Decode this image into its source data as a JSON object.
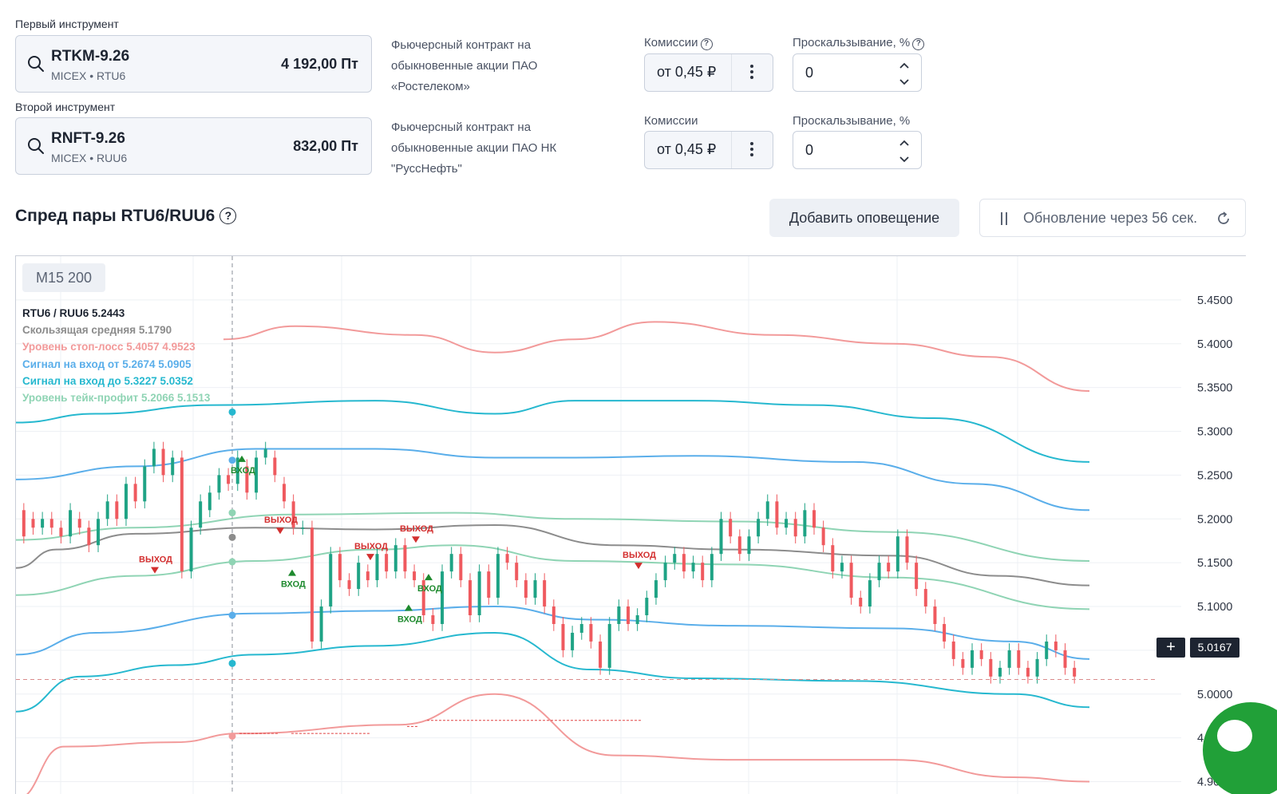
{
  "first": {
    "label": "Первый инструмент",
    "ticker": "RTKM-9.26",
    "exchange": "MICEX • RTU6",
    "price": "4 192,00 Пт",
    "description": [
      "Фьючерсный контракт на",
      "обыкновенные акции ПАО",
      "«Ростелеком»"
    ],
    "commission_label": "Комиссии",
    "commission_value": "от 0,45 ₽",
    "slippage_label": "Проскальзывание, %",
    "slippage_value": "0"
  },
  "second": {
    "label": "Второй инструмент",
    "ticker": "RNFT-9.26",
    "exchange": "MICEX • RUU6",
    "price": "832,00 Пт",
    "description": [
      "Фьючерсный контракт на",
      "обыкновенные акции ПАО НК",
      "\"РуссНефть\""
    ],
    "commission_label": "Комиссии",
    "commission_value": "от 0,45 ₽",
    "slippage_label": "Проскальзывание, %",
    "slippage_value": "0"
  },
  "spread": {
    "title": "Спред пары RTU6/RUU6",
    "add_alert": "Добавить оповещение",
    "refresh": "Обновление через 56 сек."
  },
  "chart_data": {
    "type": "candlestick",
    "timeframe_badge": "M15 200",
    "current_price": "5.0167",
    "legend": [
      {
        "text": "RTU6 / RUU6 5.2443",
        "color": "#1d2431"
      },
      {
        "text": "Скользящая средняя 5.1790",
        "color": "#8c8c8c"
      },
      {
        "text": "Уровень стоп-лосс 5.4057 4.9523",
        "color": "#f29a9a"
      },
      {
        "text": "Сигнал на вход от 5.2674 5.0905",
        "color": "#5aaeea"
      },
      {
        "text": "Сигнал на вход до 5.3227 5.0352",
        "color": "#26b8cf"
      },
      {
        "text": "Уровень тейк-профит 5.2066 5.1513",
        "color": "#8fd4b4"
      }
    ],
    "y_ticks": [
      "5.4500",
      "5.4000",
      "5.3500",
      "5.3000",
      "5.2500",
      "5.2000",
      "5.1500",
      "5.1000",
      "5.0500",
      "5.0000",
      "4.9500",
      "4.9000"
    ],
    "ylim": [
      4.885,
      5.5
    ],
    "signal_labels": {
      "entry": "ВХОД",
      "exit": "ВЫХОД"
    },
    "colors": {
      "up": "#1fa385",
      "down": "#ef5a5f",
      "ma": "#8c8c8c",
      "sl": "#f29a9a",
      "entry_from": "#5aaeea",
      "entry_to": "#26b8cf",
      "tp": "#8fd4b4"
    },
    "ma": [
      [
        0,
        5.144
      ],
      [
        50,
        5.165
      ],
      [
        150,
        5.183
      ],
      [
        300,
        5.19
      ],
      [
        450,
        5.188
      ],
      [
        600,
        5.193
      ],
      [
        750,
        5.17
      ],
      [
        900,
        5.165
      ],
      [
        1100,
        5.158
      ],
      [
        1230,
        5.135
      ],
      [
        1345,
        5.124
      ]
    ],
    "stop_upper": [
      [
        260,
        5.405
      ],
      [
        350,
        5.42
      ],
      [
        500,
        5.41
      ],
      [
        600,
        5.39
      ],
      [
        700,
        5.405
      ],
      [
        800,
        5.425
      ],
      [
        950,
        5.41
      ],
      [
        1100,
        5.4
      ],
      [
        1220,
        5.385
      ],
      [
        1345,
        5.346
      ]
    ],
    "stop_lower": [
      [
        0,
        4.88
      ],
      [
        60,
        4.94
      ],
      [
        200,
        4.945
      ],
      [
        280,
        4.955
      ],
      [
        480,
        4.965
      ],
      [
        600,
        5.0
      ],
      [
        750,
        4.93
      ],
      [
        900,
        4.925
      ],
      [
        1100,
        4.925
      ],
      [
        1250,
        4.905
      ],
      [
        1345,
        4.9
      ]
    ],
    "entry_to_upper": [
      [
        0,
        5.31
      ],
      [
        100,
        5.32
      ],
      [
        250,
        5.33
      ],
      [
        450,
        5.335
      ],
      [
        600,
        5.32
      ],
      [
        700,
        5.335
      ],
      [
        850,
        5.335
      ],
      [
        1000,
        5.33
      ],
      [
        1150,
        5.315
      ],
      [
        1345,
        5.265
      ]
    ],
    "entry_to_lower": [
      [
        0,
        4.98
      ],
      [
        80,
        5.02
      ],
      [
        200,
        5.033
      ],
      [
        300,
        5.045
      ],
      [
        450,
        5.055
      ],
      [
        600,
        5.07
      ],
      [
        720,
        5.028
      ],
      [
        850,
        5.018
      ],
      [
        1050,
        5.015
      ],
      [
        1250,
        5.0
      ],
      [
        1345,
        4.985
      ]
    ],
    "entry_from_upper": [
      [
        0,
        5.245
      ],
      [
        150,
        5.26
      ],
      [
        300,
        5.28
      ],
      [
        450,
        5.28
      ],
      [
        600,
        5.27
      ],
      [
        700,
        5.27
      ],
      [
        850,
        5.272
      ],
      [
        1050,
        5.265
      ],
      [
        1200,
        5.24
      ],
      [
        1345,
        5.21
      ]
    ],
    "entry_from_lower": [
      [
        0,
        5.045
      ],
      [
        100,
        5.07
      ],
      [
        300,
        5.092
      ],
      [
        450,
        5.095
      ],
      [
        600,
        5.1
      ],
      [
        720,
        5.085
      ],
      [
        900,
        5.078
      ],
      [
        1100,
        5.075
      ],
      [
        1250,
        5.06
      ],
      [
        1345,
        5.04
      ]
    ],
    "tp_upper": [
      [
        0,
        5.176
      ],
      [
        150,
        5.19
      ],
      [
        350,
        5.205
      ],
      [
        550,
        5.207
      ],
      [
        700,
        5.2
      ],
      [
        900,
        5.197
      ],
      [
        1100,
        5.185
      ],
      [
        1345,
        5.152
      ]
    ],
    "tp_lower": [
      [
        0,
        5.113
      ],
      [
        150,
        5.135
      ],
      [
        300,
        5.152
      ],
      [
        450,
        5.165
      ],
      [
        550,
        5.17
      ],
      [
        700,
        5.152
      ],
      [
        900,
        5.148
      ],
      [
        1100,
        5.133
      ],
      [
        1345,
        5.097
      ]
    ],
    "crosshair_x": 271,
    "candles": [
      [
        5.21,
        5.18
      ],
      [
        5.2,
        5.19
      ],
      [
        5.19,
        5.2
      ],
      [
        5.2,
        5.19
      ],
      [
        5.19,
        5.18
      ],
      [
        5.18,
        5.21
      ],
      [
        5.2,
        5.19
      ],
      [
        5.19,
        5.17
      ],
      [
        5.17,
        5.2
      ],
      [
        5.2,
        5.22
      ],
      [
        5.22,
        5.2
      ],
      [
        5.2,
        5.24
      ],
      [
        5.24,
        5.22
      ],
      [
        5.22,
        5.26
      ],
      [
        5.26,
        5.28
      ],
      [
        5.28,
        5.25
      ],
      [
        5.25,
        5.27
      ],
      [
        5.27,
        5.14
      ],
      [
        5.14,
        5.19
      ],
      [
        5.19,
        5.22
      ],
      [
        5.21,
        5.23
      ],
      [
        5.23,
        5.25
      ],
      [
        5.25,
        5.24
      ],
      [
        5.24,
        5.27
      ],
      [
        5.26,
        5.23
      ],
      [
        5.23,
        5.27
      ],
      [
        5.27,
        5.28
      ],
      [
        5.27,
        5.25
      ],
      [
        5.24,
        5.22
      ],
      [
        5.22,
        5.19
      ],
      [
        5.19,
        5.19
      ],
      [
        5.19,
        5.06
      ],
      [
        5.06,
        5.1
      ],
      [
        5.1,
        5.16
      ],
      [
        5.16,
        5.13
      ],
      [
        5.13,
        5.12
      ],
      [
        5.12,
        5.15
      ],
      [
        5.14,
        5.13
      ],
      [
        5.13,
        5.16
      ],
      [
        5.16,
        5.14
      ],
      [
        5.14,
        5.17
      ],
      [
        5.17,
        5.14
      ],
      [
        5.14,
        5.13
      ],
      [
        5.13,
        5.09
      ],
      [
        5.09,
        5.08
      ],
      [
        5.08,
        5.14
      ],
      [
        5.14,
        5.16
      ],
      [
        5.16,
        5.13
      ],
      [
        5.13,
        5.09
      ],
      [
        5.09,
        5.14
      ],
      [
        5.14,
        5.11
      ],
      [
        5.11,
        5.16
      ],
      [
        5.16,
        5.15
      ],
      [
        5.15,
        5.13
      ],
      [
        5.13,
        5.11
      ],
      [
        5.11,
        5.13
      ],
      [
        5.13,
        5.1
      ],
      [
        5.1,
        5.08
      ],
      [
        5.08,
        5.05
      ],
      [
        5.05,
        5.07
      ],
      [
        5.07,
        5.08
      ],
      [
        5.08,
        5.06
      ],
      [
        5.06,
        5.03
      ],
      [
        5.03,
        5.08
      ],
      [
        5.08,
        5.1
      ],
      [
        5.1,
        5.08
      ],
      [
        5.08,
        5.09
      ],
      [
        5.09,
        5.11
      ],
      [
        5.11,
        5.13
      ],
      [
        5.13,
        5.15
      ],
      [
        5.15,
        5.16
      ],
      [
        5.16,
        5.14
      ],
      [
        5.14,
        5.15
      ],
      [
        5.15,
        5.13
      ],
      [
        5.13,
        5.16
      ],
      [
        5.16,
        5.2
      ],
      [
        5.2,
        5.18
      ],
      [
        5.18,
        5.16
      ],
      [
        5.16,
        5.18
      ],
      [
        5.18,
        5.2
      ],
      [
        5.2,
        5.22
      ],
      [
        5.22,
        5.19
      ],
      [
        5.19,
        5.2
      ],
      [
        5.2,
        5.18
      ],
      [
        5.18,
        5.21
      ],
      [
        5.21,
        5.19
      ],
      [
        5.19,
        5.17
      ],
      [
        5.17,
        5.14
      ],
      [
        5.14,
        5.15
      ],
      [
        5.15,
        5.11
      ],
      [
        5.11,
        5.1
      ],
      [
        5.1,
        5.13
      ],
      [
        5.13,
        5.15
      ],
      [
        5.15,
        5.14
      ],
      [
        5.14,
        5.18
      ],
      [
        5.18,
        5.15
      ],
      [
        5.15,
        5.12
      ],
      [
        5.12,
        5.1
      ],
      [
        5.1,
        5.08
      ],
      [
        5.08,
        5.06
      ],
      [
        5.06,
        5.04
      ],
      [
        5.04,
        5.03
      ],
      [
        5.03,
        5.05
      ],
      [
        5.05,
        5.04
      ],
      [
        5.04,
        5.02
      ],
      [
        5.02,
        5.03
      ],
      [
        5.03,
        5.05
      ],
      [
        5.05,
        5.03
      ],
      [
        5.03,
        5.02
      ],
      [
        5.02,
        5.04
      ],
      [
        5.04,
        5.06
      ],
      [
        5.06,
        5.05
      ],
      [
        5.05,
        5.03
      ],
      [
        5.03,
        5.02
      ]
    ]
  },
  "assets": {
    "search_icon": "search-icon",
    "question_icon": "question-icon",
    "more_icon": "more-vertical-icon",
    "spinner_icon": "chevron-updown-icon",
    "pause_icon": "pause-icon",
    "refresh_icon": "refresh-icon",
    "plus_icon": "plus-icon",
    "chat_icon": "chat-icon"
  }
}
